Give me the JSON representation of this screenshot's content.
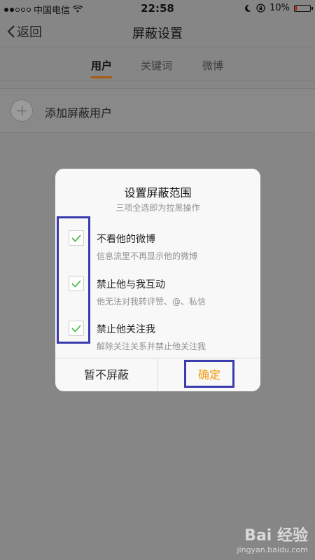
{
  "status_bar": {
    "carrier": "中国电信",
    "time": "22:58",
    "battery": "10%",
    "battery_fraction": 0.1
  },
  "nav": {
    "back_label": "返回",
    "title": "屏蔽设置"
  },
  "tabs": [
    {
      "label": "用户",
      "active": true
    },
    {
      "label": "关键词",
      "active": false
    },
    {
      "label": "微博",
      "active": false
    }
  ],
  "add_row": {
    "label": "添加屏蔽用户"
  },
  "dialog": {
    "title": "设置屏蔽范围",
    "subtitle": "三项全选即为拉黑操作",
    "options": [
      {
        "title": "不看他的微博",
        "desc": "信息流里不再显示他的微博",
        "checked": true
      },
      {
        "title": "禁止他与我互动",
        "desc": "他无法对我转评赞、@、私信",
        "checked": true
      },
      {
        "title": "禁止他关注我",
        "desc": "解除关注关系并禁止他关注我",
        "checked": true
      }
    ],
    "cancel_label": "暂不屏蔽",
    "confirm_label": "确定"
  },
  "watermark": {
    "main": "Bai 经验",
    "sub": "jingyan.baidu.com"
  },
  "colors": {
    "accent": "#f29a0c",
    "highlight_box": "#3d3bb0",
    "check_green": "#3fb43f"
  }
}
